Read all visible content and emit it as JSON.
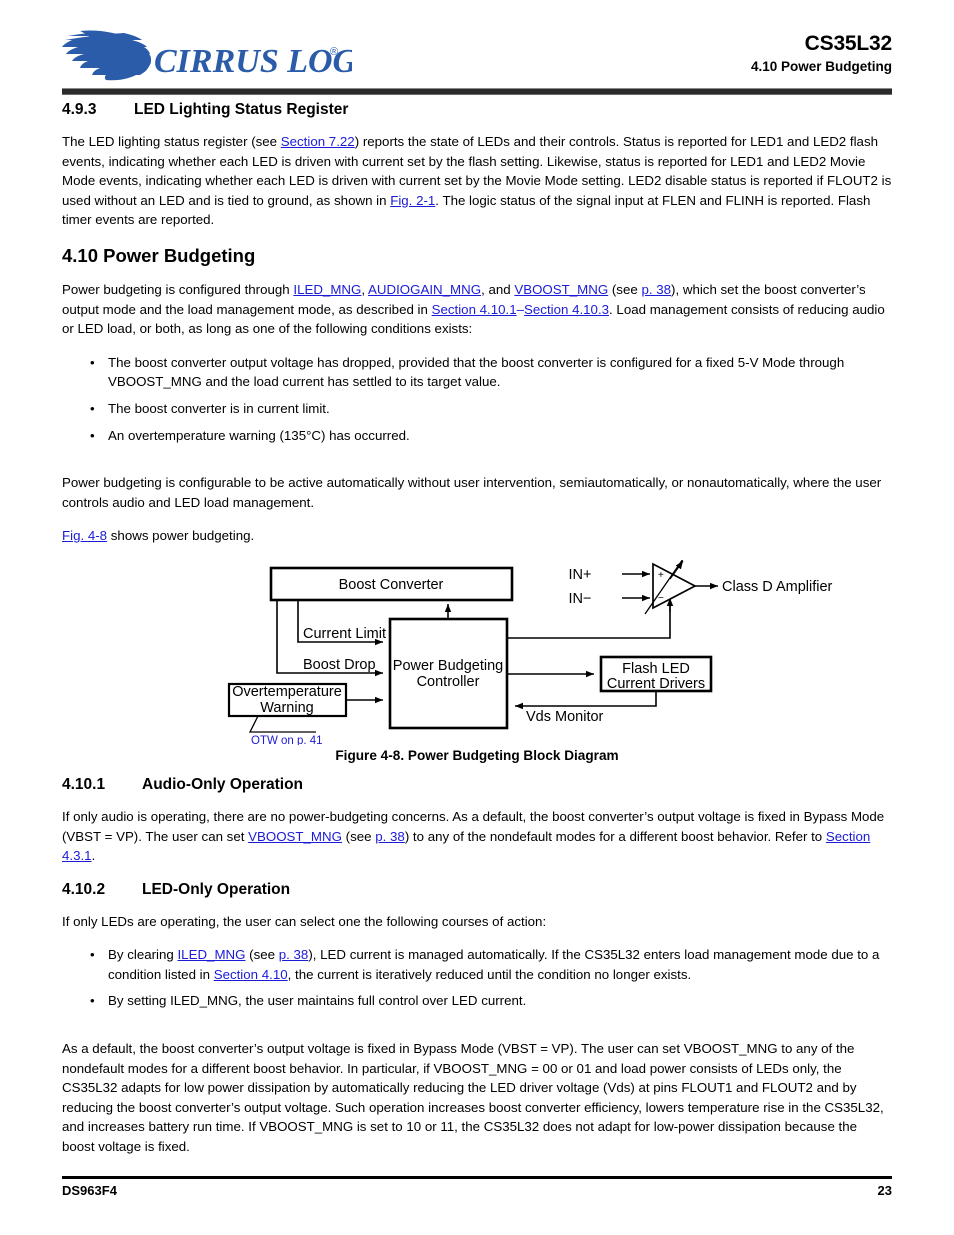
{
  "header": {
    "logo_text": "CIRRUS LOGIC",
    "logo_registered": "®",
    "doc_title": "CS35L32",
    "doc_subtitle": "4.10 Power Budgeting"
  },
  "sections": {
    "s493": {
      "number": "4.9.3",
      "title": "LED Lighting Status Register",
      "para1_a": "The LED lighting status register (see ",
      "para1_link1": "Section 7.22",
      "para1_b": ") reports the state of LEDs and their controls. Status is reported for LED1 and LED2 flash events, indicating whether each LED is driven with current set by the flash setting. Likewise, status is reported for LED1 and LED2 Movie Mode events, indicating whether each LED is driven with current set by the Movie Mode setting. LED2 disable status is reported if FLOUT2 is used without an LED and is tied to ground, as shown in ",
      "para1_link2": "Fig. 2-1",
      "para1_c": ". The logic status of the signal input at FLEN and FLINH is reported. Flash timer events are reported."
    },
    "s410": {
      "number": "4.10",
      "title": "Power Budgeting",
      "para1_a": "Power budgeting is configured through ",
      "para1_link1": "ILED_MNG",
      "para1_b": ", ",
      "para1_link2": "AUDIOGAIN_MNG",
      "para1_c": ", and ",
      "para1_link3": "VBOOST_MNG",
      "para1_d": " (see ",
      "para1_link4": "p. 38",
      "para1_e": "), which set the boost converter’s output mode and the load management mode, as described in ",
      "para1_link5": "Section 4.10.1",
      "para1_f": "–",
      "para1_link6": "Section 4.10.3",
      "para1_g": ". Load management consists of reducing audio or LED load, or both, as long as one of the following conditions exists:",
      "bullets": [
        "The boost converter output voltage has dropped, provided that the boost converter is configured for a fixed 5-V Mode through VBOOST_MNG and the load current has settled to its target value.",
        "The boost converter is in current limit.",
        "An overtemperature warning (135°C) has occurred."
      ],
      "para2": "Power budgeting is configurable to be active automatically without user intervention, semiautomatically, or nonautomatically, where the user controls audio and LED load management.",
      "para3_link": "Fig. 4-8",
      "para3_text": " shows power budgeting."
    },
    "s4101": {
      "number": "4.10.1",
      "title": "Audio-Only Operation",
      "para1_a": "If only audio is operating, there are no power-budgeting concerns. As a default, the boost converter’s output voltage is fixed in Bypass Mode (VBST = VP). The user can set ",
      "para1_link1": "VBOOST_MNG",
      "para1_b": " (see ",
      "para1_link2": "p. 38",
      "para1_c": ") to any of the nondefault modes for a different boost behavior. Refer to ",
      "para1_link3": "Section 4.3.1",
      "para1_d": "."
    },
    "s4102": {
      "number": "4.10.2",
      "title": "LED-Only Operation",
      "para1": "If only LEDs are operating, the user can select one the following courses of action:",
      "bullet1_a": "By clearing ",
      "bullet1_link1": "ILED_MNG",
      "bullet1_b": " (see ",
      "bullet1_link2": "p. 38",
      "bullet1_c": "), LED current is managed automatically. If the CS35L32 enters load management mode due to a condition listed in ",
      "bullet1_link3": "Section 4.10",
      "bullet1_d": ", the current is iteratively reduced until the condition no longer exists.",
      "bullet2": "By setting ILED_MNG, the user maintains full control over LED current.",
      "para2": "As a default, the boost converter’s output voltage is fixed in Bypass Mode (VBST = VP). The user can set VBOOST_MNG to any of the nondefault modes for a different boost behavior. In particular, if VBOOST_MNG = 00 or 01 and load power consists of LEDs only, the CS35L32 adapts for low power dissipation by automatically reducing the LED driver voltage (Vds) at pins FLOUT1 and FLOUT2 and by reducing the boost converter’s output voltage. Such operation increases boost converter efficiency, lowers temperature rise in the CS35L32, and increases battery run time. If VBOOST_MNG is set to 10 or 11, the CS35L32 does not adapt for low-power dissipation because the boost voltage is fixed."
    }
  },
  "figure": {
    "caption": "Figure 4-8. Power Budgeting Block Diagram",
    "blocks": {
      "boost_converter": "Boost Converter",
      "controller_line1": "Power Budgeting",
      "controller_line2": "Controller",
      "overtemp_line1": "Overtemperature",
      "overtemp_line2": "Warning",
      "flash_led_line1": "Flash LED",
      "flash_led_line2": "Current Drivers"
    },
    "labels": {
      "current_limit": "Current Limit",
      "boost_drop": "Boost Drop",
      "vds_monitor": "Vds Monitor",
      "in_plus": "IN+",
      "in_minus": "IN−",
      "class_d": "Class D Amplifier",
      "amp_plus": "+",
      "amp_minus": "−",
      "otw_link": "OTW on p. 41"
    }
  },
  "footer": {
    "doc_id": "DS963F4",
    "page_number": "23"
  },
  "colors": {
    "link": "#1b1bd8",
    "logo_blue": "#2a5caa",
    "rule": "#2b2b2b"
  }
}
